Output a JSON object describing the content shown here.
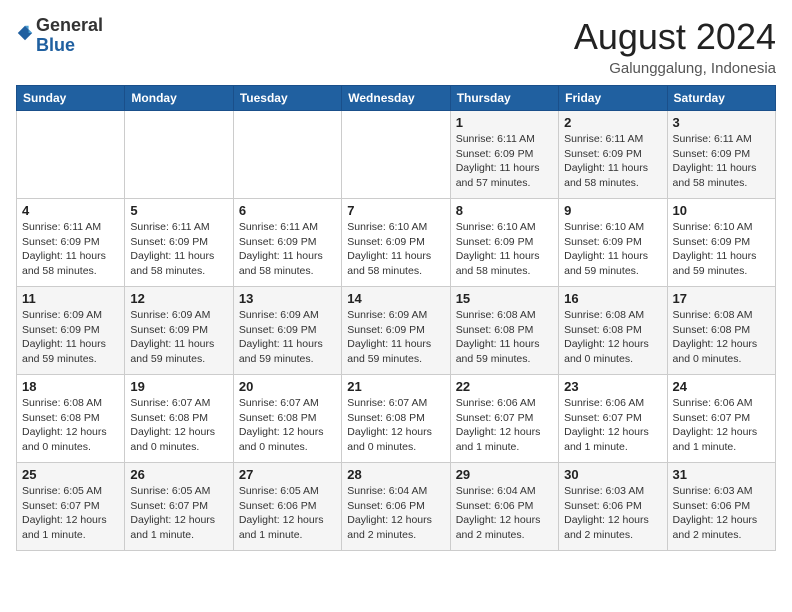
{
  "header": {
    "logo_general": "General",
    "logo_blue": "Blue",
    "title": "August 2024",
    "subtitle": "Galunggalung, Indonesia"
  },
  "weekdays": [
    "Sunday",
    "Monday",
    "Tuesday",
    "Wednesday",
    "Thursday",
    "Friday",
    "Saturday"
  ],
  "weeks": [
    [
      {
        "day": "",
        "info": ""
      },
      {
        "day": "",
        "info": ""
      },
      {
        "day": "",
        "info": ""
      },
      {
        "day": "",
        "info": ""
      },
      {
        "day": "1",
        "info": "Sunrise: 6:11 AM\nSunset: 6:09 PM\nDaylight: 11 hours\nand 57 minutes."
      },
      {
        "day": "2",
        "info": "Sunrise: 6:11 AM\nSunset: 6:09 PM\nDaylight: 11 hours\nand 58 minutes."
      },
      {
        "day": "3",
        "info": "Sunrise: 6:11 AM\nSunset: 6:09 PM\nDaylight: 11 hours\nand 58 minutes."
      }
    ],
    [
      {
        "day": "4",
        "info": "Sunrise: 6:11 AM\nSunset: 6:09 PM\nDaylight: 11 hours\nand 58 minutes."
      },
      {
        "day": "5",
        "info": "Sunrise: 6:11 AM\nSunset: 6:09 PM\nDaylight: 11 hours\nand 58 minutes."
      },
      {
        "day": "6",
        "info": "Sunrise: 6:11 AM\nSunset: 6:09 PM\nDaylight: 11 hours\nand 58 minutes."
      },
      {
        "day": "7",
        "info": "Sunrise: 6:10 AM\nSunset: 6:09 PM\nDaylight: 11 hours\nand 58 minutes."
      },
      {
        "day": "8",
        "info": "Sunrise: 6:10 AM\nSunset: 6:09 PM\nDaylight: 11 hours\nand 58 minutes."
      },
      {
        "day": "9",
        "info": "Sunrise: 6:10 AM\nSunset: 6:09 PM\nDaylight: 11 hours\nand 59 minutes."
      },
      {
        "day": "10",
        "info": "Sunrise: 6:10 AM\nSunset: 6:09 PM\nDaylight: 11 hours\nand 59 minutes."
      }
    ],
    [
      {
        "day": "11",
        "info": "Sunrise: 6:09 AM\nSunset: 6:09 PM\nDaylight: 11 hours\nand 59 minutes."
      },
      {
        "day": "12",
        "info": "Sunrise: 6:09 AM\nSunset: 6:09 PM\nDaylight: 11 hours\nand 59 minutes."
      },
      {
        "day": "13",
        "info": "Sunrise: 6:09 AM\nSunset: 6:09 PM\nDaylight: 11 hours\nand 59 minutes."
      },
      {
        "day": "14",
        "info": "Sunrise: 6:09 AM\nSunset: 6:09 PM\nDaylight: 11 hours\nand 59 minutes."
      },
      {
        "day": "15",
        "info": "Sunrise: 6:08 AM\nSunset: 6:08 PM\nDaylight: 11 hours\nand 59 minutes."
      },
      {
        "day": "16",
        "info": "Sunrise: 6:08 AM\nSunset: 6:08 PM\nDaylight: 12 hours\nand 0 minutes."
      },
      {
        "day": "17",
        "info": "Sunrise: 6:08 AM\nSunset: 6:08 PM\nDaylight: 12 hours\nand 0 minutes."
      }
    ],
    [
      {
        "day": "18",
        "info": "Sunrise: 6:08 AM\nSunset: 6:08 PM\nDaylight: 12 hours\nand 0 minutes."
      },
      {
        "day": "19",
        "info": "Sunrise: 6:07 AM\nSunset: 6:08 PM\nDaylight: 12 hours\nand 0 minutes."
      },
      {
        "day": "20",
        "info": "Sunrise: 6:07 AM\nSunset: 6:08 PM\nDaylight: 12 hours\nand 0 minutes."
      },
      {
        "day": "21",
        "info": "Sunrise: 6:07 AM\nSunset: 6:08 PM\nDaylight: 12 hours\nand 0 minutes."
      },
      {
        "day": "22",
        "info": "Sunrise: 6:06 AM\nSunset: 6:07 PM\nDaylight: 12 hours\nand 1 minute."
      },
      {
        "day": "23",
        "info": "Sunrise: 6:06 AM\nSunset: 6:07 PM\nDaylight: 12 hours\nand 1 minute."
      },
      {
        "day": "24",
        "info": "Sunrise: 6:06 AM\nSunset: 6:07 PM\nDaylight: 12 hours\nand 1 minute."
      }
    ],
    [
      {
        "day": "25",
        "info": "Sunrise: 6:05 AM\nSunset: 6:07 PM\nDaylight: 12 hours\nand 1 minute."
      },
      {
        "day": "26",
        "info": "Sunrise: 6:05 AM\nSunset: 6:07 PM\nDaylight: 12 hours\nand 1 minute."
      },
      {
        "day": "27",
        "info": "Sunrise: 6:05 AM\nSunset: 6:06 PM\nDaylight: 12 hours\nand 1 minute."
      },
      {
        "day": "28",
        "info": "Sunrise: 6:04 AM\nSunset: 6:06 PM\nDaylight: 12 hours\nand 2 minutes."
      },
      {
        "day": "29",
        "info": "Sunrise: 6:04 AM\nSunset: 6:06 PM\nDaylight: 12 hours\nand 2 minutes."
      },
      {
        "day": "30",
        "info": "Sunrise: 6:03 AM\nSunset: 6:06 PM\nDaylight: 12 hours\nand 2 minutes."
      },
      {
        "day": "31",
        "info": "Sunrise: 6:03 AM\nSunset: 6:06 PM\nDaylight: 12 hours\nand 2 minutes."
      }
    ]
  ]
}
